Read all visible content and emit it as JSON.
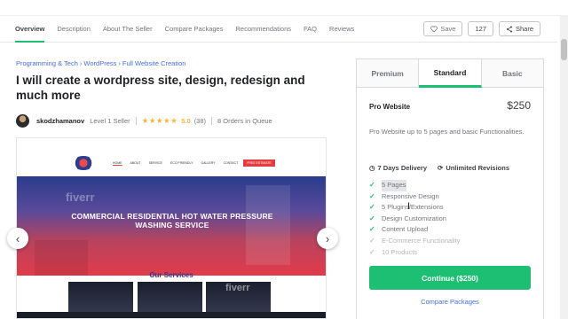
{
  "nav": {
    "tabs": [
      "Overview",
      "Description",
      "About The Seller",
      "Compare Packages",
      "Recommendations",
      "FAQ",
      "Reviews"
    ],
    "save_label": "Save",
    "likes_count": "127",
    "share_label": "Share"
  },
  "breadcrumb": [
    "Programming & Tech",
    "WordPress",
    "Full Website Creation"
  ],
  "gig": {
    "title": "I will create a wordpress site, design, redesign and much more"
  },
  "seller": {
    "name": "skodzhamanov",
    "level": "Level 1 Seller",
    "stars": "★★★★★",
    "rating": "5.0",
    "reviews": "(38)",
    "orders_in_queue": "8 Orders in Queue"
  },
  "gallery": {
    "menu": [
      "HOME",
      "ABOUT",
      "SERVICE",
      "ECO FRIENDLY",
      "GALLERY",
      "CONTACT"
    ],
    "cta": "FREE ESTIMATE",
    "watermark": "fiverr",
    "hero_text": "COMMERCIAL RESIDENTIAL HOT WATER PRESSURE WASHING SERVICE",
    "services_title": "Our Services"
  },
  "packages": {
    "tabs": [
      "Premium",
      "Standard",
      "Basic"
    ],
    "active_tab": "Standard",
    "name": "Pro Website",
    "price": "$250",
    "description": "Pro Website up to 5 pages and basic Functionalities.",
    "delivery": "7 Days Delivery",
    "revisions": "Unlimited Revisions",
    "features": [
      {
        "label": "5 Pages",
        "included": true
      },
      {
        "label": "Responsive Design",
        "included": true
      },
      {
        "label": "5 Plugins/Extensions",
        "included": true
      },
      {
        "label": "Design Customization",
        "included": true
      },
      {
        "label": "Content Upload",
        "included": true
      },
      {
        "label": "E-Commerce Functionality",
        "included": false
      },
      {
        "label": "10 Products",
        "included": false
      }
    ],
    "continue_label": "Continue ($250)",
    "compare_label": "Compare Packages"
  },
  "colors": {
    "accent": "#1dbf73",
    "link": "#446ee7",
    "star": "#ffb33e"
  }
}
